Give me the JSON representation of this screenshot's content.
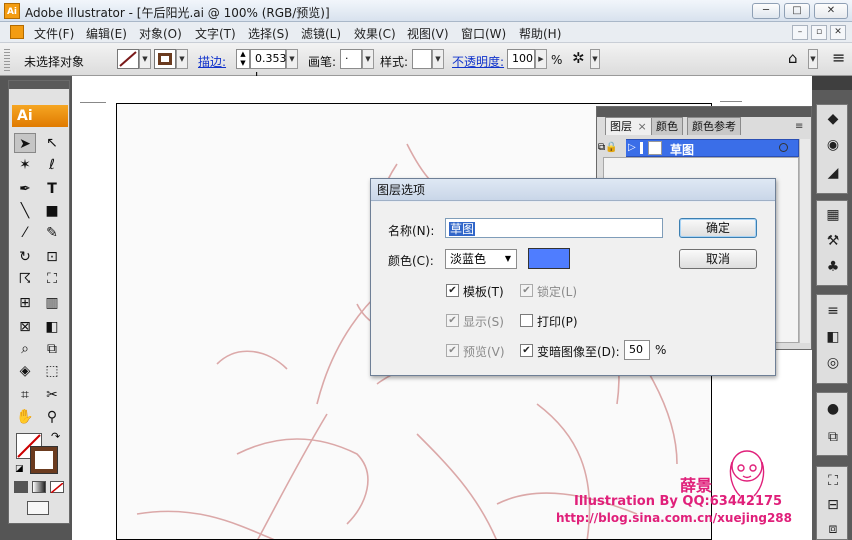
{
  "window": {
    "app_badge": "Ai",
    "title": "Adobe Illustrator - [午后阳光.ai @ 100% (RGB/预览)]",
    "min": "─",
    "max": "□",
    "close": "✕"
  },
  "menubar": {
    "items": [
      "文件(F)",
      "编辑(E)",
      "对象(O)",
      "文字(T)",
      "选择(S)",
      "滤镜(L)",
      "效果(C)",
      "视图(V)",
      "窗口(W)",
      "帮助(H)"
    ],
    "mdi_min": "–",
    "mdi_restore": "▫",
    "mdi_close": "✕"
  },
  "controlbar": {
    "no_selection": "未选择对象",
    "stroke_label": "描边:",
    "stroke_value": "0.353 I",
    "brush_label": "画笔:",
    "brush_value": "·",
    "style_label": "样式:",
    "opacity_label": "不透明度:",
    "opacity_value": "100",
    "percent": "%",
    "stroke_color": "#7a1a1a",
    "fill_color": "#6b3b1f"
  },
  "toolbox": {
    "brand": "Ai",
    "fill_color": "#ffffff",
    "stroke_color": "#6b3b1f"
  },
  "layers_panel": {
    "tabs": [
      "图层",
      "颜色",
      "颜色参考"
    ],
    "tab_close": "×",
    "layer_name": "草图"
  },
  "dialog": {
    "title": "图层选项",
    "name_label": "名称(N):",
    "name_value": "草图",
    "color_label": "颜色(C):",
    "color_value": "淡蓝色",
    "swatch_color": "#4f7dff",
    "ok_button": "确定",
    "cancel_button": "取消",
    "checkboxes": {
      "template": {
        "label": "模板(T)",
        "checked": true,
        "enabled": true
      },
      "lock": {
        "label": "锁定(L)",
        "checked": true,
        "enabled": false
      },
      "show": {
        "label": "显示(S)",
        "checked": true,
        "enabled": false
      },
      "print": {
        "label": "打印(P)",
        "checked": false,
        "enabled": true
      },
      "preview": {
        "label": "预览(V)",
        "checked": true,
        "enabled": false
      },
      "dim": {
        "label": "变暗图像至(D):",
        "checked": true,
        "enabled": true
      }
    },
    "dim_value": "50",
    "dim_unit": "%"
  },
  "watermark": {
    "name": "薛景",
    "credit": "Illustration By QQ:63442175",
    "url": "http://blog.sina.com.cn/xuejing288"
  }
}
